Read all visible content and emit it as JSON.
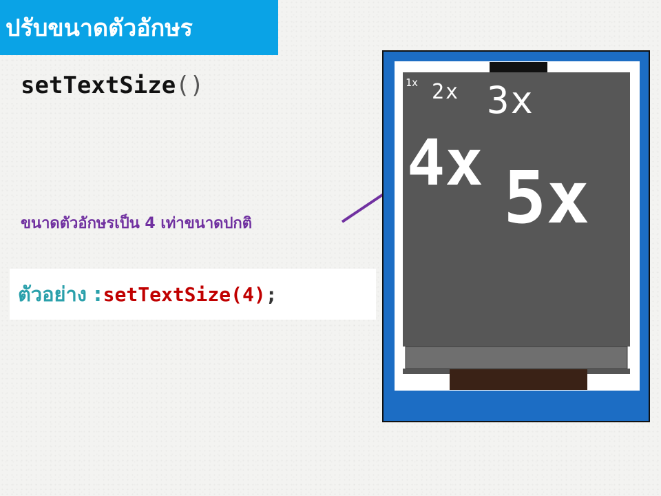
{
  "slide": {
    "title": "ปรับขนาดตัวอักษร",
    "function_name": "setTextSize",
    "function_parens": "()",
    "caption": "ขนาดตัวอักษรเป็น 4 เท่าขนาดปกติ",
    "example_label": "ตัวอย่าง : ",
    "example_code": "setTextSize(4)",
    "example_semicolon": ";"
  },
  "lcd": {
    "labels": [
      "1x",
      "2x",
      "3x",
      "4x",
      "5x"
    ]
  },
  "colors": {
    "title_bar": "#0aa3e6",
    "caption": "#7030a0",
    "example_label": "#2aa0ab",
    "example_code": "#c00000",
    "module_board": "#1c6dc4",
    "lcd_screen": "#575757",
    "lcd_text": "#ffffff",
    "arrow": "#7030a0"
  }
}
